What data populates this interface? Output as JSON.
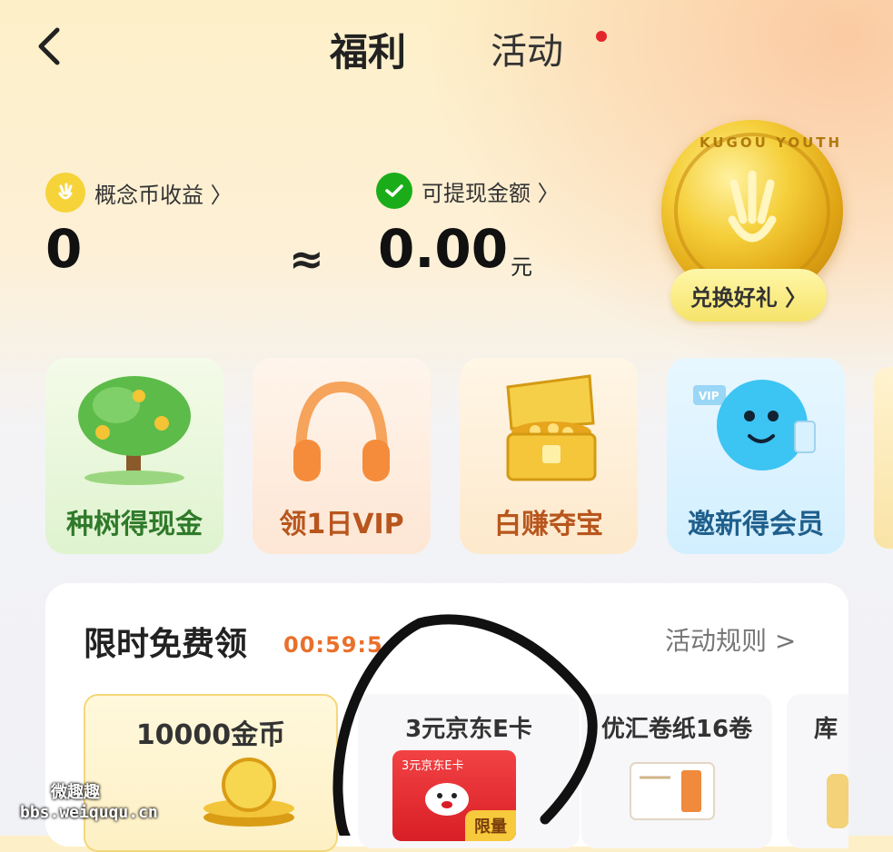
{
  "header": {
    "tab_active": "福利",
    "tab_other": "活动"
  },
  "balance": {
    "coin_label": "概念币收益 〉",
    "coin_value": "0",
    "approx": "≈",
    "cash_label": "可提现金额 〉",
    "cash_value": "0.00",
    "cash_unit": "元"
  },
  "medal": {
    "text": "KUGOU YOUTH",
    "exchange_label": "兑换好礼 〉"
  },
  "tiles": [
    {
      "label": "种树得现金",
      "icon": "money-tree-icon"
    },
    {
      "label": "领1日VIP",
      "icon": "headphones-icon"
    },
    {
      "label": "白赚夺宝",
      "icon": "treasure-chest-icon"
    },
    {
      "label": "邀新得会员",
      "icon": "vip-mascot-icon"
    }
  ],
  "section": {
    "title": "限时免费领",
    "timer": "00:59:5",
    "rules": "活动规则 >"
  },
  "prizes": [
    {
      "name": "10000金币",
      "icon": "gold-coins-icon"
    },
    {
      "name": "3元京东E卡",
      "card_text": "3元京东E卡",
      "badge": "限量",
      "icon": "jd-dog-icon"
    },
    {
      "name": "优汇卷纸16卷",
      "icon": "tissue-pack-icon"
    },
    {
      "name": "库"
    }
  ],
  "watermark": {
    "line1": "微趣趣",
    "line2": "bbs.weiququ.cn"
  },
  "colors": {
    "timer": "#e9702b",
    "red_dot": "#e4252c",
    "gold": "#f5cf3a",
    "wechat_green": "#1aad19"
  }
}
